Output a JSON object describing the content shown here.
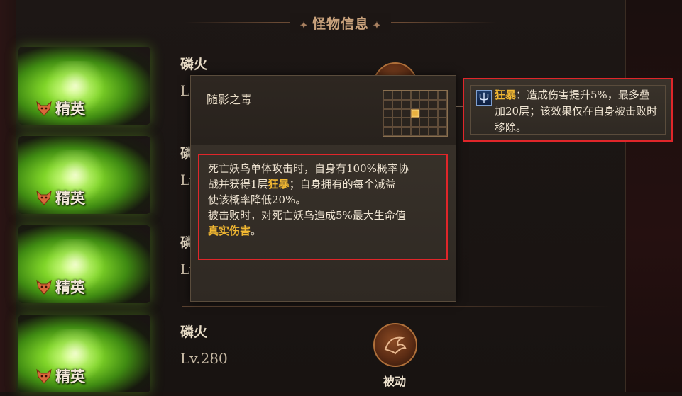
{
  "window": {
    "title": "怪物信息"
  },
  "monsters": [
    {
      "name": "磷火",
      "level": "Lv",
      "badge": "精英"
    },
    {
      "name": "磷",
      "level": "Lv",
      "badge": "精英"
    },
    {
      "name": "磷",
      "level": "Lv",
      "badge": "精英"
    },
    {
      "name": "磷火",
      "level": "Lv.280",
      "badge": "精英",
      "skill_label": "被动"
    }
  ],
  "tooltip": {
    "title": "随影之毒",
    "grid": {
      "cols": 7,
      "rows": 5,
      "active": [
        [
          3,
          2
        ]
      ]
    },
    "description": [
      [
        {
          "text": "死亡妖鸟单体攻击时，自身有100%概率协"
        }
      ],
      [
        {
          "text": "战并获得1层"
        },
        {
          "text": "狂暴",
          "highlight": true
        },
        {
          "text": "；自身拥有的每个减益"
        }
      ],
      [
        {
          "text": "使该概率降低20%。"
        }
      ],
      [
        {
          "text": "被击败时，对死亡妖鸟造成5%最大生命值"
        }
      ],
      [
        {
          "text": "真实伤害",
          "highlight": true
        },
        {
          "text": "。"
        }
      ]
    ]
  },
  "buff_tip": {
    "keyword": "狂暴",
    "text": "：造成伤害提升5%，最多叠加20层；该效果仅在自身被击败时移除。",
    "icon": "trident-buff-icon"
  },
  "colors": {
    "highlight": "#f2b832",
    "annotation_box": "#e0262a",
    "elite_glow": "#7fd428"
  }
}
